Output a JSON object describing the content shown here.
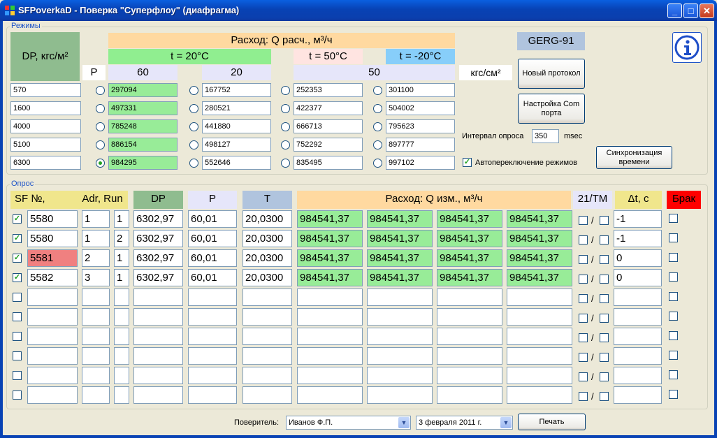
{
  "window": {
    "title": "SFPoverkaD - Поверка \"Суперфлоу\" (диафрагма)",
    "minimize": "_",
    "maximize": "□",
    "close": "✕"
  },
  "regimes": {
    "label": "Режимы",
    "dp_header": "DP, кгс/м²",
    "flow_header": "Расход: Q расч., м³/ч",
    "p_header": "P",
    "t20": "t = 20°C",
    "t50": "t = 50°C",
    "tm20": "t = -20°C",
    "p60": "60",
    "p20": "20",
    "p50": "50",
    "gerg": "GERG-91",
    "pressure_unit": "кгс/см²",
    "dp": [
      "570",
      "1600",
      "4000",
      "5100",
      "6300"
    ],
    "col60": [
      "297094",
      "497331",
      "785248",
      "886154",
      "984295"
    ],
    "col20": [
      "167752",
      "280521",
      "441880",
      "498127",
      "552646"
    ],
    "col50a": [
      "252353",
      "422377",
      "666713",
      "752292",
      "835495"
    ],
    "col50b": [
      "301100",
      "504002",
      "795623",
      "897777",
      "997102"
    ],
    "selected_row": 4,
    "new_protocol": "Новый протокол",
    "com_setup": "Настройка Com порта",
    "interval_label": "Интервал опроса",
    "interval_value": "350",
    "interval_unit": "msec",
    "auto_switch": "Автопереключение режимов",
    "auto_switch_checked": true,
    "time_sync": "Синхронизация времени",
    "info_icon": "info-icon"
  },
  "survey": {
    "label": "Опрос",
    "h_sf": "SF №,",
    "h_adr": "Adr, Run",
    "h_dp": "DP",
    "h_p": "P",
    "h_t": "T",
    "h_flow": "Расход: Q изм., м³/ч",
    "h_21tm": "21/TM",
    "h_dt": "Δt, c",
    "h_reject": "Брак",
    "slash": "/",
    "rows": [
      {
        "checked": true,
        "sf": "5580",
        "adr": "1",
        "run": "1",
        "dp": "6302,97",
        "p": "60,01",
        "t": "20,0300",
        "q": [
          "984541,37",
          "984541,37",
          "984541,37",
          "984541,37"
        ],
        "dt": "-1",
        "error": false
      },
      {
        "checked": true,
        "sf": "5580",
        "adr": "1",
        "run": "2",
        "dp": "6302,97",
        "p": "60,01",
        "t": "20,0300",
        "q": [
          "984541,37",
          "984541,37",
          "984541,37",
          "984541,37"
        ],
        "dt": "-1",
        "error": false
      },
      {
        "checked": true,
        "sf": "5581",
        "adr": "2",
        "run": "1",
        "dp": "6302,97",
        "p": "60,01",
        "t": "20,0300",
        "q": [
          "984541,37",
          "984541,37",
          "984541,37",
          "984541,37"
        ],
        "dt": "0",
        "error": true
      },
      {
        "checked": true,
        "sf": "5582",
        "adr": "3",
        "run": "1",
        "dp": "6302,97",
        "p": "60,01",
        "t": "20,0300",
        "q": [
          "984541,37",
          "984541,37",
          "984541,37",
          "984541,37"
        ],
        "dt": "0",
        "error": false
      },
      {
        "checked": false,
        "sf": "",
        "adr": "",
        "run": "",
        "dp": "",
        "p": "",
        "t": "",
        "q": [
          "",
          "",
          "",
          ""
        ],
        "dt": "",
        "error": false
      },
      {
        "checked": false,
        "sf": "",
        "adr": "",
        "run": "",
        "dp": "",
        "p": "",
        "t": "",
        "q": [
          "",
          "",
          "",
          ""
        ],
        "dt": "",
        "error": false
      },
      {
        "checked": false,
        "sf": "",
        "adr": "",
        "run": "",
        "dp": "",
        "p": "",
        "t": "",
        "q": [
          "",
          "",
          "",
          ""
        ],
        "dt": "",
        "error": false
      },
      {
        "checked": false,
        "sf": "",
        "adr": "",
        "run": "",
        "dp": "",
        "p": "",
        "t": "",
        "q": [
          "",
          "",
          "",
          ""
        ],
        "dt": "",
        "error": false
      },
      {
        "checked": false,
        "sf": "",
        "adr": "",
        "run": "",
        "dp": "",
        "p": "",
        "t": "",
        "q": [
          "",
          "",
          "",
          ""
        ],
        "dt": "",
        "error": false
      },
      {
        "checked": false,
        "sf": "",
        "adr": "",
        "run": "",
        "dp": "",
        "p": "",
        "t": "",
        "q": [
          "",
          "",
          "",
          ""
        ],
        "dt": "",
        "error": false
      }
    ]
  },
  "footer": {
    "verifier_label": "Поверитель:",
    "verifier_value": "Иванов Ф.П.",
    "date_value": "3 февраля 2011 г.",
    "print": "Печать"
  },
  "colors": {
    "green": "#98ec98",
    "orange": "#ffd9a0",
    "red_cell": "#f08080",
    "reject": "#ff0000",
    "dp_hdr": "#8fbc8f",
    "lavender": "#e6e6fa",
    "steel": "#b0c4de",
    "yellow": "#f0e68c",
    "pink": "#ffe4e1",
    "lightblue": "#87cefa",
    "lightgreen": "#90ee90"
  }
}
